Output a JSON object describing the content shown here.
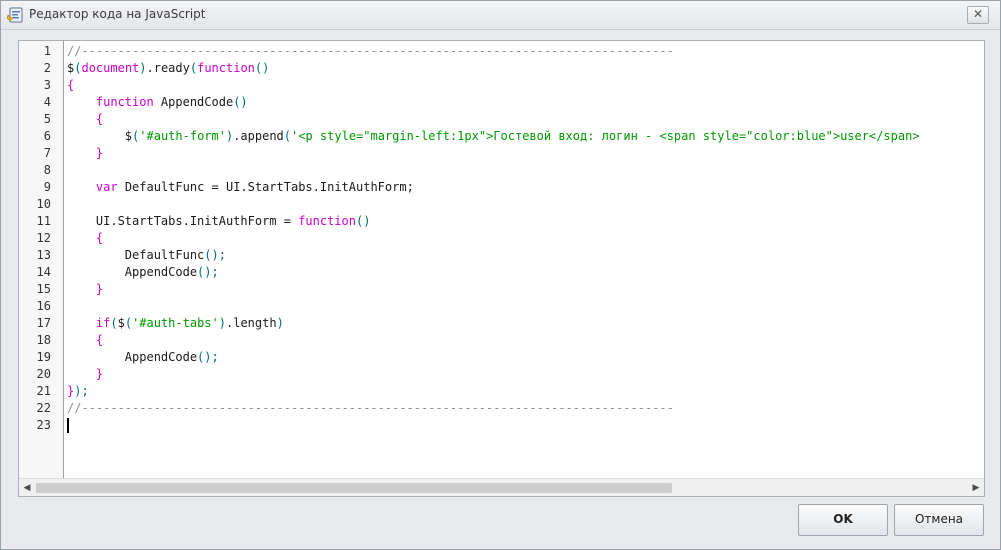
{
  "window": {
    "title": "Редактор кода на JavaScript",
    "close_label": "✕"
  },
  "editor": {
    "lines": [
      [
        {
          "t": "comment",
          "v": "//----------------------------------------------------------------------------------"
        }
      ],
      [
        {
          "t": "id",
          "v": "$"
        },
        {
          "t": "punc",
          "v": "("
        },
        {
          "t": "kw",
          "v": "document"
        },
        {
          "t": "punc",
          "v": ")"
        },
        {
          "t": "id",
          "v": ".ready"
        },
        {
          "t": "punc",
          "v": "("
        },
        {
          "t": "kw",
          "v": "function"
        },
        {
          "t": "punc",
          "v": "()"
        }
      ],
      [
        {
          "t": "kw",
          "v": "{"
        }
      ],
      [
        {
          "t": "id",
          "v": "    "
        },
        {
          "t": "kw",
          "v": "function"
        },
        {
          "t": "id",
          "v": " AppendCode"
        },
        {
          "t": "punc",
          "v": "()"
        }
      ],
      [
        {
          "t": "id",
          "v": "    "
        },
        {
          "t": "kw",
          "v": "{"
        }
      ],
      [
        {
          "t": "id",
          "v": "        $"
        },
        {
          "t": "punc",
          "v": "("
        },
        {
          "t": "str",
          "v": "'#auth-form'"
        },
        {
          "t": "punc",
          "v": ")"
        },
        {
          "t": "id",
          "v": ".append"
        },
        {
          "t": "punc",
          "v": "("
        },
        {
          "t": "str",
          "v": "'<p style=\"margin-left:1px\">Гостевой вход: логин - <span style=\"color:blue\">user</span>"
        }
      ],
      [
        {
          "t": "id",
          "v": "    "
        },
        {
          "t": "kw",
          "v": "}"
        }
      ],
      [
        {
          "t": "id",
          "v": ""
        }
      ],
      [
        {
          "t": "id",
          "v": "    "
        },
        {
          "t": "kw",
          "v": "var"
        },
        {
          "t": "id",
          "v": " DefaultFunc = UI.StartTabs.InitAuthForm;"
        }
      ],
      [
        {
          "t": "id",
          "v": ""
        }
      ],
      [
        {
          "t": "id",
          "v": "    UI.StartTabs.InitAuthForm = "
        },
        {
          "t": "kw",
          "v": "function"
        },
        {
          "t": "punc",
          "v": "()"
        }
      ],
      [
        {
          "t": "id",
          "v": "    "
        },
        {
          "t": "kw",
          "v": "{"
        }
      ],
      [
        {
          "t": "id",
          "v": "        DefaultFunc"
        },
        {
          "t": "punc",
          "v": "();"
        }
      ],
      [
        {
          "t": "id",
          "v": "        AppendCode"
        },
        {
          "t": "punc",
          "v": "();"
        }
      ],
      [
        {
          "t": "id",
          "v": "    "
        },
        {
          "t": "kw",
          "v": "}"
        }
      ],
      [
        {
          "t": "id",
          "v": ""
        }
      ],
      [
        {
          "t": "id",
          "v": "    "
        },
        {
          "t": "kw",
          "v": "if"
        },
        {
          "t": "punc",
          "v": "("
        },
        {
          "t": "id",
          "v": "$"
        },
        {
          "t": "punc",
          "v": "("
        },
        {
          "t": "str",
          "v": "'#auth-tabs'"
        },
        {
          "t": "punc",
          "v": ")"
        },
        {
          "t": "id",
          "v": ".length"
        },
        {
          "t": "punc",
          "v": ")"
        }
      ],
      [
        {
          "t": "id",
          "v": "    "
        },
        {
          "t": "kw",
          "v": "{"
        }
      ],
      [
        {
          "t": "id",
          "v": "        AppendCode"
        },
        {
          "t": "punc",
          "v": "();"
        }
      ],
      [
        {
          "t": "id",
          "v": "    "
        },
        {
          "t": "kw",
          "v": "}"
        }
      ],
      [
        {
          "t": "kw",
          "v": "}"
        },
        {
          "t": "punc",
          "v": ");"
        }
      ],
      [
        {
          "t": "comment",
          "v": "//----------------------------------------------------------------------------------"
        }
      ],
      [
        {
          "t": "id",
          "v": ""
        }
      ]
    ],
    "line_numbers": [
      "1",
      "2",
      "3",
      "4",
      "5",
      "6",
      "7",
      "8",
      "9",
      "10",
      "11",
      "12",
      "13",
      "14",
      "15",
      "16",
      "17",
      "18",
      "19",
      "20",
      "21",
      "22",
      "23"
    ],
    "cursor_line": 23,
    "scroll_left_arrow": "◀",
    "scroll_right_arrow": "▶"
  },
  "buttons": {
    "ok_label": "OK",
    "cancel_label": "Отмена"
  },
  "colors": {
    "comment": "#8e8e8e",
    "keyword": "#cc00cc",
    "string": "#009900",
    "identifier": "#1a1a1a",
    "punctuation": "#006d6d"
  },
  "icons": {
    "window": "js-editor-icon",
    "close": "close-icon"
  }
}
